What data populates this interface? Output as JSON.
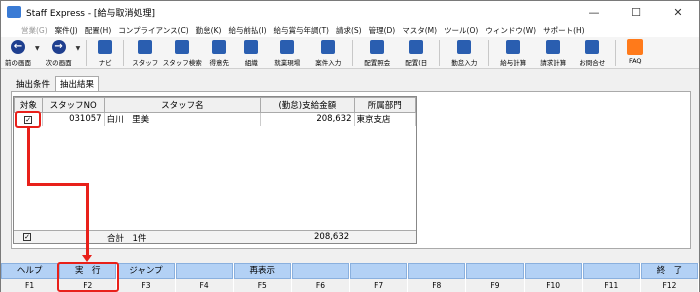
{
  "window": {
    "title": "Staff Express - [給与取消処理]",
    "minimize": "—",
    "maximize": "☐",
    "close": "✕"
  },
  "menu": [
    {
      "label": "営業(G)",
      "dim": true
    },
    {
      "label": "案件(J)"
    },
    {
      "label": "配置(H)"
    },
    {
      "label": "コンプライアンス(C)"
    },
    {
      "label": "勤怠(K)"
    },
    {
      "label": "給与前払(I)"
    },
    {
      "label": "給与賞与年調(T)"
    },
    {
      "label": "請求(S)"
    },
    {
      "label": "管理(D)"
    },
    {
      "label": "マスタ(M)"
    },
    {
      "label": "ツール(O)"
    },
    {
      "label": "ウィンドウ(W)"
    },
    {
      "label": "サポート(H)"
    }
  ],
  "toolbar": {
    "prev": "前の画面",
    "next": "次の画面",
    "navi": "ナビ",
    "staff": "スタッフ",
    "staff_search": "スタッフ検索",
    "client": "得意先",
    "org": "組織",
    "site": "就業現場",
    "case_input": "案件入力",
    "assign_inquiry": "配置照会",
    "assign_day": "配置(日",
    "attendance": "勤怠入力",
    "payroll": "給与計算",
    "billing": "請求計算",
    "contact": "お問合せ",
    "faq": "FAQ"
  },
  "tabs": {
    "criteria": "抽出条件",
    "result": "抽出結果"
  },
  "grid": {
    "headers": [
      "対象",
      "スタッフNO",
      "スタッフ名",
      "(勤怠)支給金額",
      "所属部門"
    ],
    "rows": [
      {
        "checked": "✓",
        "staff_no": "031057",
        "name": "白川　里美",
        "amount": "208,632",
        "dept": "東京支店"
      }
    ],
    "summary": {
      "checked": "✓",
      "label": "合計　1件",
      "amount": "208,632"
    }
  },
  "fkeys": [
    {
      "label": "ヘルプ",
      "key": "F1"
    },
    {
      "label": "実　行",
      "key": "F2"
    },
    {
      "label": "ジャンプ",
      "key": "F3"
    },
    {
      "label": "",
      "key": "F4"
    },
    {
      "label": "再表示",
      "key": "F5"
    },
    {
      "label": "",
      "key": "F6"
    },
    {
      "label": "",
      "key": "F7"
    },
    {
      "label": "",
      "key": "F8"
    },
    {
      "label": "",
      "key": "F9"
    },
    {
      "label": "",
      "key": "F10"
    },
    {
      "label": "",
      "key": "F11"
    },
    {
      "label": "終　了",
      "key": "F12"
    }
  ],
  "colors": {
    "annotation": "#e8201a",
    "fkey": "#b3d1f5"
  }
}
